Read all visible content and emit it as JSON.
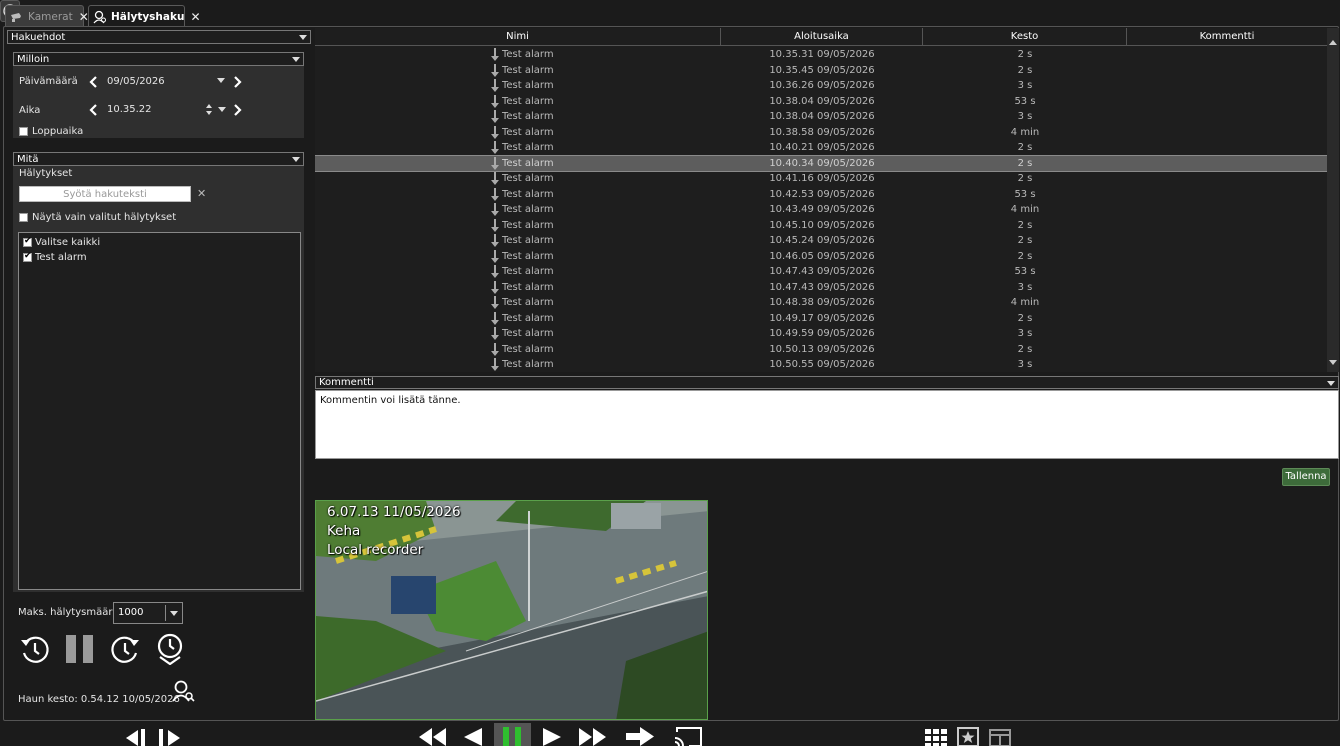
{
  "tabs": [
    {
      "label": "Kamerat",
      "icon": "camera-icon"
    },
    {
      "label": "Hälytyshaku",
      "icon": "user-search-icon"
    }
  ],
  "left": {
    "criteria_label": "Hakuehdot",
    "when": {
      "header": "Milloin",
      "date_label": "Päivämäärä",
      "date_value": "09/05/2026",
      "time_label": "Aika",
      "time_value": "10.35.22",
      "end_time_label": "Loppuaika",
      "end_time_checked": false
    },
    "what": {
      "header": "Mitä",
      "alarms_label": "Hälytykset",
      "search_placeholder": "Syötä hakuteksti",
      "show_only_selected_label": "Näytä vain valitut hälytykset",
      "show_only_selected_checked": false,
      "items": [
        {
          "label": "Valitse kaikki",
          "checked": true
        },
        {
          "label": "Test alarm",
          "checked": true
        }
      ]
    },
    "max_alarms_label": "Maks. hälytysmäärä",
    "max_alarms_value": "1000",
    "search_duration": "Haun kesto: 0.54.12  10/05/2026"
  },
  "table": {
    "columns": [
      "Nimi",
      "Aloitusaika",
      "Kesto",
      "Kommentti"
    ],
    "selected_index": 7,
    "rows": [
      {
        "name": "Test alarm",
        "start": "10.35.31  09/05/2026",
        "duration": "2 s",
        "comment": ""
      },
      {
        "name": "Test alarm",
        "start": "10.35.45  09/05/2026",
        "duration": "2 s",
        "comment": ""
      },
      {
        "name": "Test alarm",
        "start": "10.36.26  09/05/2026",
        "duration": "3 s",
        "comment": ""
      },
      {
        "name": "Test alarm",
        "start": "10.38.04  09/05/2026",
        "duration": "53 s",
        "comment": ""
      },
      {
        "name": "Test alarm",
        "start": "10.38.04  09/05/2026",
        "duration": "3 s",
        "comment": ""
      },
      {
        "name": "Test alarm",
        "start": "10.38.58  09/05/2026",
        "duration": "4 min",
        "comment": ""
      },
      {
        "name": "Test alarm",
        "start": "10.40.21  09/05/2026",
        "duration": "2 s",
        "comment": ""
      },
      {
        "name": "Test alarm",
        "start": "10.40.34  09/05/2026",
        "duration": "2 s",
        "comment": ""
      },
      {
        "name": "Test alarm",
        "start": "10.41.16  09/05/2026",
        "duration": "2 s",
        "comment": ""
      },
      {
        "name": "Test alarm",
        "start": "10.42.53  09/05/2026",
        "duration": "53 s",
        "comment": ""
      },
      {
        "name": "Test alarm",
        "start": "10.43.49  09/05/2026",
        "duration": "4 min",
        "comment": ""
      },
      {
        "name": "Test alarm",
        "start": "10.45.10  09/05/2026",
        "duration": "2 s",
        "comment": ""
      },
      {
        "name": "Test alarm",
        "start": "10.45.24  09/05/2026",
        "duration": "2 s",
        "comment": ""
      },
      {
        "name": "Test alarm",
        "start": "10.46.05  09/05/2026",
        "duration": "2 s",
        "comment": ""
      },
      {
        "name": "Test alarm",
        "start": "10.47.43  09/05/2026",
        "duration": "53 s",
        "comment": ""
      },
      {
        "name": "Test alarm",
        "start": "10.47.43  09/05/2026",
        "duration": "3 s",
        "comment": ""
      },
      {
        "name": "Test alarm",
        "start": "10.48.38  09/05/2026",
        "duration": "4 min",
        "comment": ""
      },
      {
        "name": "Test alarm",
        "start": "10.49.17  09/05/2026",
        "duration": "2 s",
        "comment": ""
      },
      {
        "name": "Test alarm",
        "start": "10.49.59  09/05/2026",
        "duration": "3 s",
        "comment": ""
      },
      {
        "name": "Test alarm",
        "start": "10.50.13  09/05/2026",
        "duration": "2 s",
        "comment": ""
      },
      {
        "name": "Test alarm",
        "start": "10.50.55  09/05/2026",
        "duration": "3 s",
        "comment": ""
      }
    ]
  },
  "comment": {
    "header": "Kommentti",
    "text": "Kommentin voi lisätä tänne.",
    "save_label": "Tallenna"
  },
  "video": {
    "timestamp": "6.07.13  11/05/2026",
    "camera_name": "Keha",
    "source": "Local recorder"
  },
  "colors": {
    "background": "#1b1b1b",
    "panel": "#2f2f2f",
    "selected_row": "#5d5d5d",
    "save_button": "#3d6b3a",
    "video_border": "#5aa04a",
    "play_active": "#2fbf2f"
  }
}
